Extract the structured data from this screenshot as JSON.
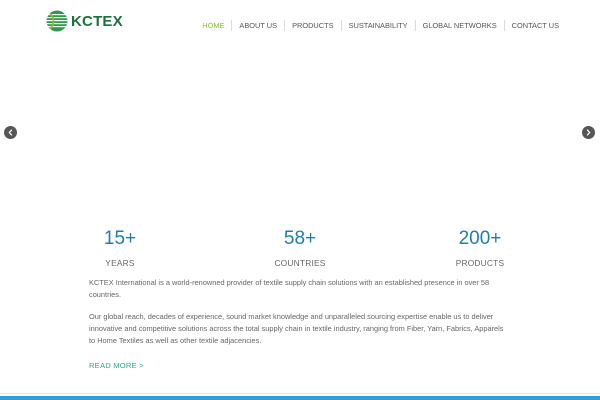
{
  "brand": {
    "name": "KCTEX",
    "colors": {
      "logo_green": "#1d6f3d",
      "nav_active": "#8dbd3b",
      "stat_blue": "#1c7fb0",
      "link_teal": "#26a98b",
      "footer_blue": "#2e9fd8"
    }
  },
  "nav": {
    "items": [
      {
        "label": "HOME",
        "active": true
      },
      {
        "label": "ABOUT US"
      },
      {
        "label": "PRODUCTS"
      },
      {
        "label": "SUSTAINABILITY"
      },
      {
        "label": "GLOBAL NETWORKS"
      },
      {
        "label": "CONTACT US"
      }
    ]
  },
  "slider": {
    "prev_icon": "chevron-left-icon",
    "next_icon": "chevron-right-icon"
  },
  "stats": [
    {
      "value": "15+",
      "label": "YEARS"
    },
    {
      "value": "58+",
      "label": "COUNTRIES"
    },
    {
      "value": "200+",
      "label": "PRODUCTS"
    }
  ],
  "about": {
    "paragraph1": "KCTEX International is a world-renowned provider of textile supply chain solutions with an established presence in over 58 countries.",
    "paragraph2": "Our global reach, decades of experience, sound market knowledge and unparalleled sourcing expertise enable us to deliver innovative and competitive solutions across the total supply chain in textile industry, ranging from Fiber, Yarn, Fabrics, Apparels to Home Textiles as well as other textile adjacencies.",
    "read_more": "READ MORE >"
  }
}
